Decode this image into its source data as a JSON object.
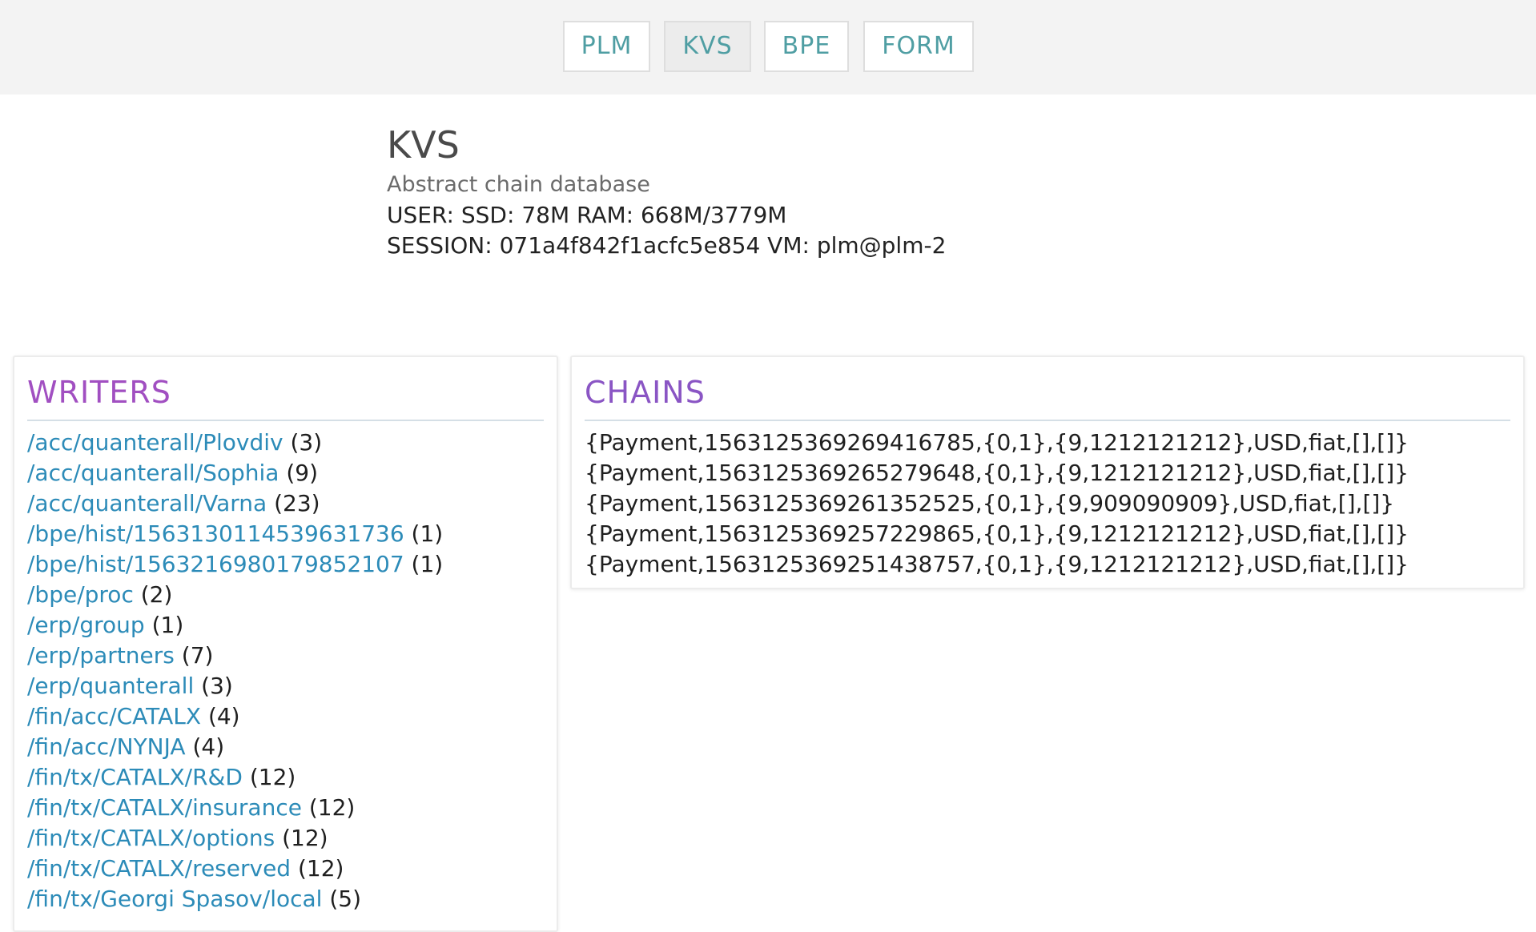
{
  "nav": {
    "tabs": [
      {
        "label": "PLM"
      },
      {
        "label": "KVS"
      },
      {
        "label": "BPE"
      },
      {
        "label": "FORM"
      }
    ],
    "active": "KVS"
  },
  "header": {
    "title": "KVS",
    "subtitle": "Abstract chain database",
    "user_line": "USER: SSD: 78M RAM: 668M/3779M",
    "session_line": "SESSION: 071a4f842f1acfc5e854 VM: plm@plm-2"
  },
  "writers": {
    "title": "WRITERS",
    "items": [
      {
        "path": "/acc/quanterall/Plovdiv",
        "count": "(3)"
      },
      {
        "path": "/acc/quanterall/Sophia",
        "count": "(9)"
      },
      {
        "path": "/acc/quanterall/Varna",
        "count": "(23)"
      },
      {
        "path": "/bpe/hist/1563130114539631736",
        "count": "(1)"
      },
      {
        "path": "/bpe/hist/1563216980179852107",
        "count": "(1)"
      },
      {
        "path": "/bpe/proc",
        "count": "(2)"
      },
      {
        "path": "/erp/group",
        "count": "(1)"
      },
      {
        "path": "/erp/partners",
        "count": "(7)"
      },
      {
        "path": "/erp/quanterall",
        "count": "(3)"
      },
      {
        "path": "/fin/acc/CATALX",
        "count": "(4)"
      },
      {
        "path": "/fin/acc/NYNJA",
        "count": "(4)"
      },
      {
        "path": "/fin/tx/CATALX/R&D",
        "count": "(12)"
      },
      {
        "path": "/fin/tx/CATALX/insurance",
        "count": "(12)"
      },
      {
        "path": "/fin/tx/CATALX/options",
        "count": "(12)"
      },
      {
        "path": "/fin/tx/CATALX/reserved",
        "count": "(12)"
      },
      {
        "path": "/fin/tx/Georgi Spasov/local",
        "count": "(5)"
      }
    ]
  },
  "chains": {
    "title": "CHAINS",
    "items": [
      "{Payment,1563125369269416785,{0,1},{9,1212121212},USD,fiat,[],[]}",
      "{Payment,1563125369265279648,{0,1},{9,1212121212},USD,fiat,[],[]}",
      "{Payment,1563125369261352525,{0,1},{9,909090909},USD,fiat,[],[]}",
      "{Payment,1563125369257229865,{0,1},{9,1212121212},USD,fiat,[],[]}",
      "{Payment,1563125369251438757,{0,1},{9,1212121212},USD,fiat,[],[]}"
    ]
  }
}
